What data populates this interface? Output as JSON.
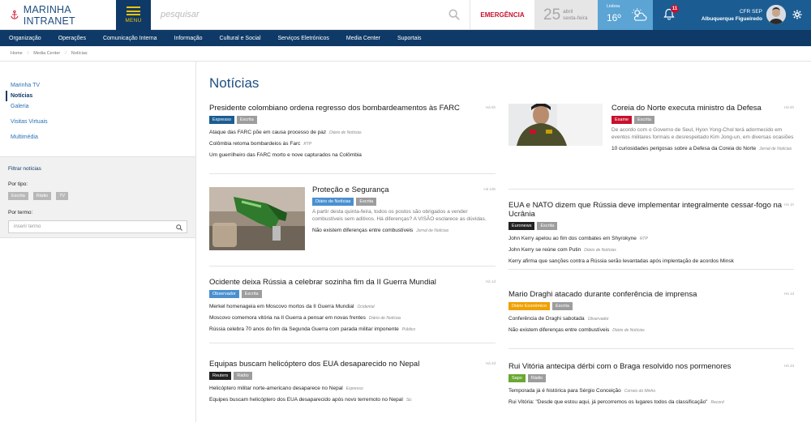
{
  "header": {
    "brand": "MARINHA INTRANET",
    "menu_label": "MENU",
    "search_placeholder": "pesquisar",
    "emergency": "EMERGÊNCIA",
    "date": {
      "day": "25",
      "month": "abril",
      "weekday": "sexta-feira"
    },
    "weather": {
      "city": "Lisboa",
      "temp": "16º"
    },
    "notifications": "11",
    "user": {
      "rank": "CFR SEP",
      "name": "Albuquerque Figueiredo"
    }
  },
  "nav": [
    "Organização",
    "Operações",
    "Comunicação Interna",
    "Informação",
    "Cultural e Social",
    "Serviços Eletrónicos",
    "Media Center",
    "Suportais"
  ],
  "breadcrumb": [
    "Home",
    "Media Center",
    "Notícias"
  ],
  "sidebar": {
    "items": [
      "Marinha TV",
      "Notícias",
      "Galeria",
      "Visitas Virtuais",
      "Multimédia"
    ],
    "filter_title": "Filtrar notícias",
    "type_label": "Por tipo:",
    "types": [
      "Escrita",
      "Rádio",
      "TV"
    ],
    "term_label": "Por termo:",
    "term_placeholder": "inserir termo"
  },
  "page_title": "Notícias",
  "articles": [
    {
      "title": "Presidente colombiano ordena regresso dos bombardeamentos às FARC",
      "ago": "Há 5h",
      "tags": [
        {
          "t": "Expresso",
          "c": "#1b5d93"
        },
        {
          "t": "Escrita",
          "c": "#9d9d9d"
        }
      ],
      "related": [
        {
          "t": "Ataque das FARC põe em causa processo de paz",
          "s": "Diário de Notícias"
        },
        {
          "t": "Colômbia retoma bombardeios às Farc",
          "s": "RTP"
        },
        {
          "t": "Um guerrilheiro das FARC morto e nove capturados na Colômbia",
          "s": ""
        }
      ]
    },
    {
      "title": "Proteção e Segurança",
      "ago": "Há 10h",
      "tags": [
        {
          "t": "Diário de Notícias",
          "c": "#4a90d0"
        },
        {
          "t": "Escrita",
          "c": "#9d9d9d"
        }
      ],
      "summary": "A partir desta quinta-feira, todos os postos são obrigados a vender combustíveis sem aditivos. Há diferenças? A VISÃO esclarece as dúvidas.",
      "related": [
        {
          "t": "Não existem diferenças entre combustíveis",
          "s": "Jornal de Notícias"
        }
      ]
    },
    {
      "title": "Ocidente deixa Rússia a celebrar sozinha fim da II Guerra Mundial",
      "ago": "Há 1d",
      "tags": [
        {
          "t": "Observador",
          "c": "#4a90d0"
        },
        {
          "t": "Escrita",
          "c": "#9d9d9d"
        }
      ],
      "related": [
        {
          "t": "Merkel homenageia em Moscovo mortos da II Guerra Mundial",
          "s": "Ocidental"
        },
        {
          "t": "Moscovo comemora vitória na II Guerra a pensar em novas frentes",
          "s": "Diário de Notícias"
        },
        {
          "t": "Rússia celebra 70 anos do fim da Segunda Guerra com parada militar imponente",
          "s": "Público"
        }
      ]
    },
    {
      "title": "Equipas buscam helicóptero dos EUA desaparecido no Nepal",
      "ago": "Há 2d",
      "tags": [
        {
          "t": "Reuters",
          "c": "#222222"
        },
        {
          "t": "Rádio",
          "c": "#9d9d9d"
        }
      ],
      "related": [
        {
          "t": "Helicóptero militar norte-americano desaparece no Nepal",
          "s": "Expresso"
        },
        {
          "t": "Equipes buscam helicóptero dos EUA desaparecido após novo terremoto no Nepal",
          "s": "Sic"
        }
      ]
    },
    {
      "title": "Coreia do Norte executa ministro da Defesa",
      "ago": "Há 5h",
      "tags": [
        {
          "t": "Exame",
          "c": "#c8102e"
        },
        {
          "t": "Escrita",
          "c": "#9d9d9d"
        }
      ],
      "summary": "De acordo com o Governo de Seul, Hyon Yong-Chol terá adormecido em eventos militares formais e desrespeitado Kim Jong-un, em diversas ocasiões",
      "related": [
        {
          "t": "10 curiosidades perigosas sobre a Defesa da Coreia do Norte",
          "s": "Jornal de Notícias"
        }
      ]
    },
    {
      "title": "EUA e NATO dizem que Rússia deve implementar integralmente cessar-fogo na Ucrânia",
      "ago": "Há 1h",
      "tags": [
        {
          "t": "Euronews",
          "c": "#222222"
        },
        {
          "t": "Escrita",
          "c": "#9d9d9d"
        }
      ],
      "related": [
        {
          "t": "John Kerry apelou ao fim dos combates em Shyrokyne",
          "s": "RTP"
        },
        {
          "t": "John Kerry se reúne com Putin",
          "s": "Diário de Notícias"
        },
        {
          "t": "Kerry afirma que sanções contra a Rússia serão levantadas após implentação de acordos Minsk",
          "s": ""
        }
      ]
    },
    {
      "title": "Mario Draghi atacado durante conferência de imprensa",
      "ago": "Há 1d",
      "tags": [
        {
          "t": "Diário Económico",
          "c": "#f0a000"
        },
        {
          "t": "Escrita",
          "c": "#9d9d9d"
        }
      ],
      "related": [
        {
          "t": "Conferência de Draghi sabotada",
          "s": "Observador"
        },
        {
          "t": "Não existem diferenças entre combustíveis",
          "s": "Diário de Notícias"
        }
      ]
    },
    {
      "title": "Rui Vitória antecipa dérbi com o Braga resolvido nos pormenores",
      "ago": "Há 2d",
      "tags": [
        {
          "t": "Sapo",
          "c": "#6aa832"
        },
        {
          "t": "Rádio",
          "c": "#9d9d9d"
        }
      ],
      "related": [
        {
          "t": "Temporada já é histórica para Sérgio Conceição",
          "s": "Correio do Minho"
        },
        {
          "t": "Rui Vitória: \"Desde que estou aqui, já percorremos os lugares todos da classificação\"",
          "s": "Record"
        }
      ]
    }
  ]
}
